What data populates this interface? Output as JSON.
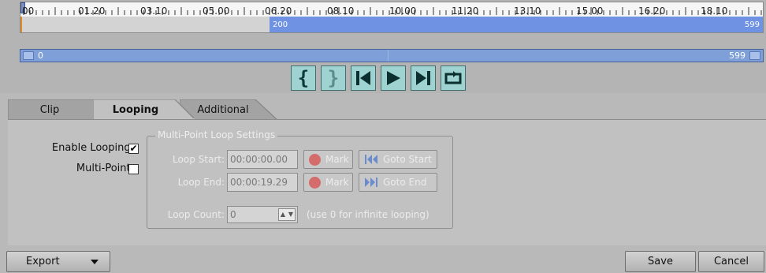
{
  "ruler": {
    "tick_labels": [
      "00",
      "01.20",
      "03.10",
      "05.00",
      "06.20",
      "08.10",
      "10.00",
      "11.20",
      "13.10",
      "15.00",
      "16.20",
      "18.10"
    ],
    "selection_start_label": "200",
    "selection_end_label": "599"
  },
  "scrollbar": {
    "start_label": "0",
    "end_label": "599"
  },
  "transport": {
    "loop_start_glyph": "{",
    "loop_end_glyph": "}"
  },
  "tabs": {
    "clip": "Clip",
    "looping": "Looping",
    "additional": "Additional"
  },
  "looping": {
    "enable_label": "Enable Looping:",
    "enable_checked": "✔",
    "multipoint_label": "Multi-Point:",
    "multipoint_checked": "",
    "group_title": "Multi-Point Loop Settings",
    "loop_start_label": "Loop Start:",
    "loop_start_value": "00:00:00.00",
    "loop_end_label": "Loop End:",
    "loop_end_value": "00:00:19.29",
    "mark_label": "Mark",
    "goto_start_label": "Goto Start",
    "goto_end_label": "Goto End",
    "loop_count_label": "Loop Count:",
    "loop_count_value": "0",
    "loop_count_hint": "(use 0 for infinite looping)"
  },
  "bottom": {
    "export_label": "Export",
    "save_label": "Save",
    "cancel_label": "Cancel"
  },
  "colors": {
    "selected_track": "#6f92e3",
    "scrollbar": "#7e9fd8",
    "transport_button": "#9fd3d1",
    "mark_dot": "#d46c6c"
  }
}
